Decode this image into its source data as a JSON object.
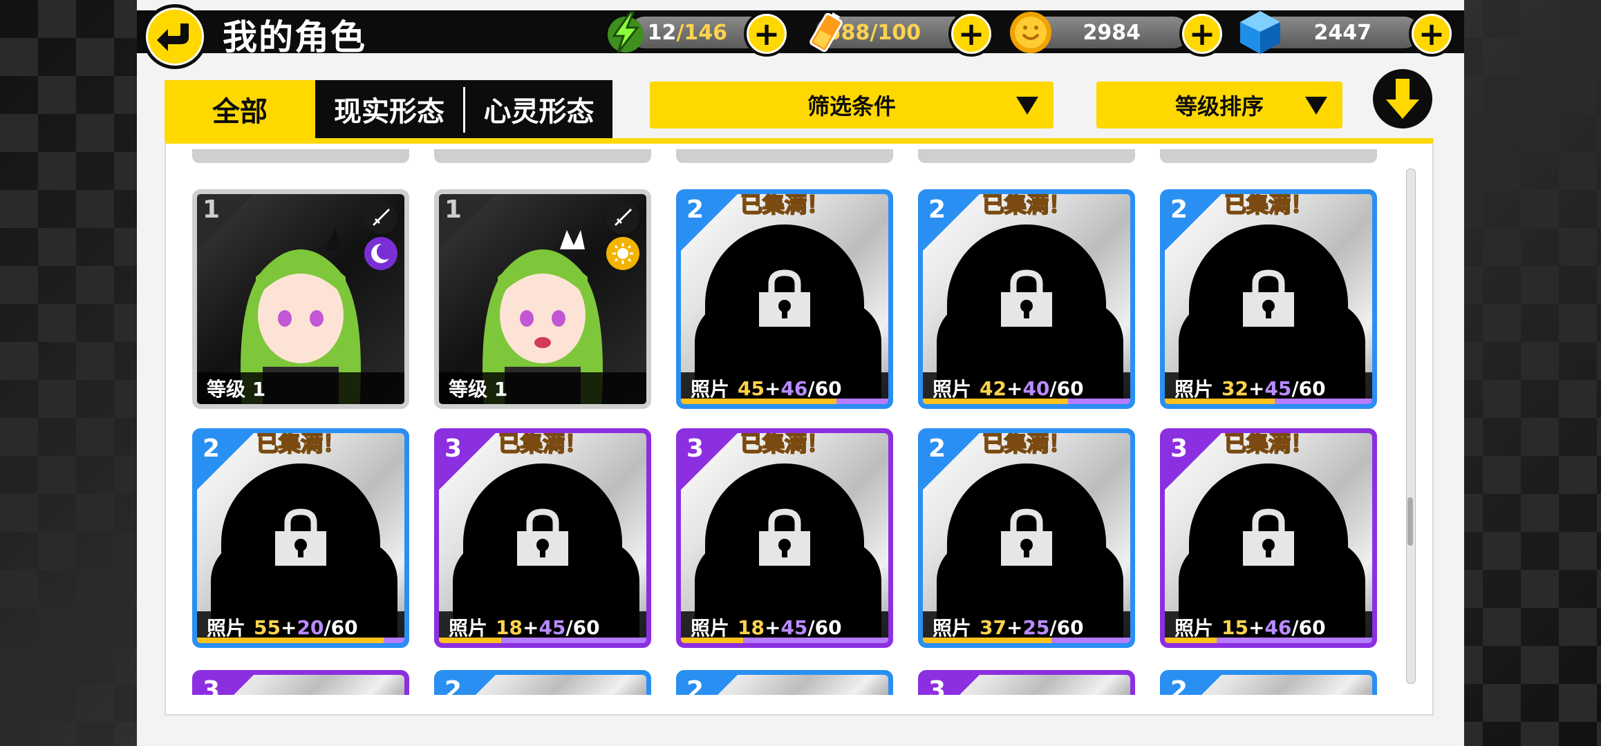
{
  "header": {
    "title": "我的角色",
    "resources": [
      {
        "name": "stamina",
        "icon": "lightning-bolt-icon",
        "current": "12",
        "max": "/146"
      },
      {
        "name": "battery",
        "icon": "battery-icon",
        "current": "588",
        "max": "/100"
      },
      {
        "name": "gold",
        "icon": "gold-coin-icon",
        "current": "2984",
        "max": ""
      },
      {
        "name": "gems",
        "icon": "blue-gem-icon",
        "current": "2447",
        "max": ""
      }
    ]
  },
  "tabs": [
    {
      "label": "全部",
      "active": true
    },
    {
      "label": "现实形态",
      "active": false
    },
    {
      "label": "心灵形态",
      "active": false
    }
  ],
  "filters": {
    "filter_label": "筛选条件",
    "sort_label": "等级排序"
  },
  "cards": [
    {
      "rarity": "1",
      "owned": true,
      "level_label": "等级 1",
      "form": "moon"
    },
    {
      "rarity": "1",
      "owned": true,
      "level_label": "等级 1",
      "form": "sun"
    },
    {
      "rarity": "2",
      "owned": false,
      "full_label": "已集满！",
      "photo_label": "照片",
      "a": "45",
      "b": "46",
      "total": "/60",
      "a_frac": 0.75,
      "b_frac": 0.25
    },
    {
      "rarity": "2",
      "owned": false,
      "full_label": "已集满！",
      "photo_label": "照片",
      "a": "42",
      "b": "40",
      "total": "/60",
      "a_frac": 0.7,
      "b_frac": 0.3
    },
    {
      "rarity": "2",
      "owned": false,
      "full_label": "已集满！",
      "photo_label": "照片",
      "a": "32",
      "b": "45",
      "total": "/60",
      "a_frac": 0.53,
      "b_frac": 0.47
    },
    {
      "rarity": "2",
      "owned": false,
      "full_label": "已集满！",
      "photo_label": "照片",
      "a": "55",
      "b": "20",
      "total": "/60",
      "a_frac": 0.9,
      "b_frac": 0.1
    },
    {
      "rarity": "3",
      "owned": false,
      "full_label": "已集满！",
      "photo_label": "照片",
      "a": "18",
      "b": "45",
      "total": "/60",
      "a_frac": 0.3,
      "b_frac": 0.7
    },
    {
      "rarity": "3",
      "owned": false,
      "full_label": "已集满！",
      "photo_label": "照片",
      "a": "18",
      "b": "45",
      "total": "/60",
      "a_frac": 0.3,
      "b_frac": 0.7
    },
    {
      "rarity": "2",
      "owned": false,
      "full_label": "已集满！",
      "photo_label": "照片",
      "a": "37",
      "b": "25",
      "total": "/60",
      "a_frac": 0.62,
      "b_frac": 0.38
    },
    {
      "rarity": "3",
      "owned": false,
      "full_label": "已集满！",
      "photo_label": "照片",
      "a": "15",
      "b": "46",
      "total": "/60",
      "a_frac": 0.25,
      "b_frac": 0.75
    }
  ],
  "peek_rows": [
    {
      "rarity": "3"
    },
    {
      "rarity": "2"
    },
    {
      "rarity": "2"
    },
    {
      "rarity": "3"
    },
    {
      "rarity": "2"
    }
  ],
  "colors": {
    "accent": "#ffd800",
    "rarity2": "#2a8ff2",
    "rarity3": "#8c2fe0",
    "progress_a": "#ffc21a",
    "progress_b": "#b57cff"
  }
}
